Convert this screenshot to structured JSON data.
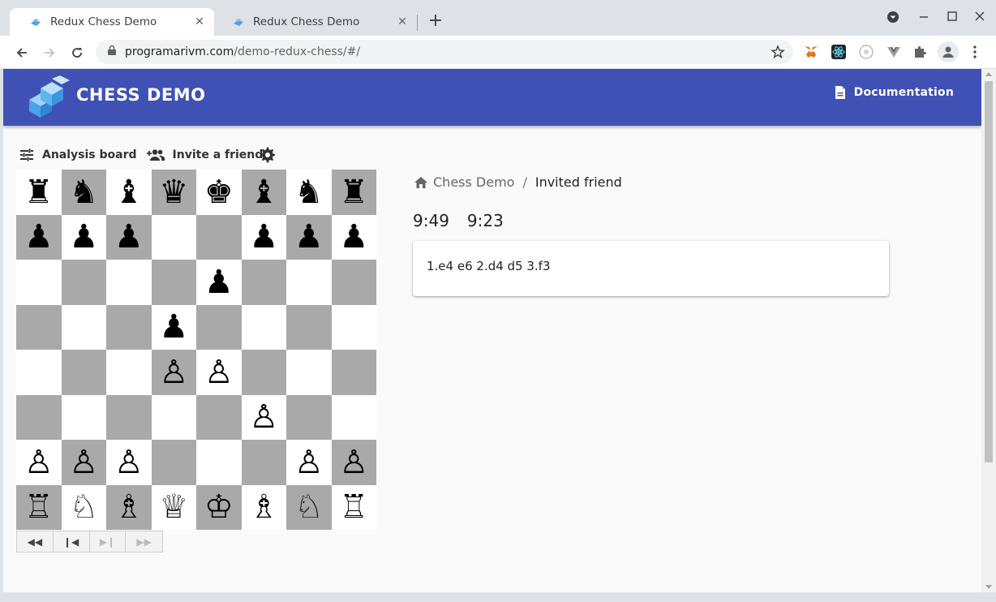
{
  "browser": {
    "tabs": [
      {
        "title": "Redux Chess Demo",
        "active": true
      },
      {
        "title": "Redux Chess Demo",
        "active": false
      }
    ],
    "url_host": "programarivm.com",
    "url_path": "/demo-redux-chess/#/",
    "extension_icons": [
      "metamask-icon",
      "react-devtools-icon",
      "extension-icon",
      "vue-devtools-icon",
      "puzzle-extensions-icon",
      "profile-icon",
      "kebab-menu-icon"
    ]
  },
  "app": {
    "brand_color": "#3f51b5",
    "logo_text": "CHESS DEMO",
    "documentation_label": "Documentation",
    "actions": {
      "analysis_board": "Analysis board",
      "invite_friend": "Invite a friend"
    },
    "breadcrumb": {
      "home": "Chess Demo",
      "separator": "/",
      "current": "Invited friend"
    },
    "timers": {
      "white": "9:49",
      "black": "9:23"
    },
    "moves": "1.e4 e6 2.d4 d5 3.f3",
    "board": [
      [
        "♜",
        "♞",
        "♝",
        "♛",
        "♚",
        "♝",
        "♞",
        "♜"
      ],
      [
        "♟",
        "♟",
        "♟",
        "",
        "",
        "♟",
        "♟",
        "♟"
      ],
      [
        "",
        "",
        "",
        "",
        "♟",
        "",
        "",
        ""
      ],
      [
        "",
        "",
        "",
        "♟",
        "",
        "",
        "",
        ""
      ],
      [
        "",
        "",
        "",
        "♙",
        "♙",
        "",
        "",
        ""
      ],
      [
        "",
        "",
        "",
        "",
        "",
        "♙",
        "",
        ""
      ],
      [
        "♙",
        "♙",
        "♙",
        "",
        "",
        "",
        "♙",
        "♙"
      ],
      [
        "♖",
        "♘",
        "♗",
        "♕",
        "♔",
        "♗",
        "♘",
        "♖"
      ]
    ],
    "history_nav": {
      "first": "◀◀",
      "prev": "❙◀",
      "next": "▶❙",
      "last": "▶▶"
    }
  }
}
